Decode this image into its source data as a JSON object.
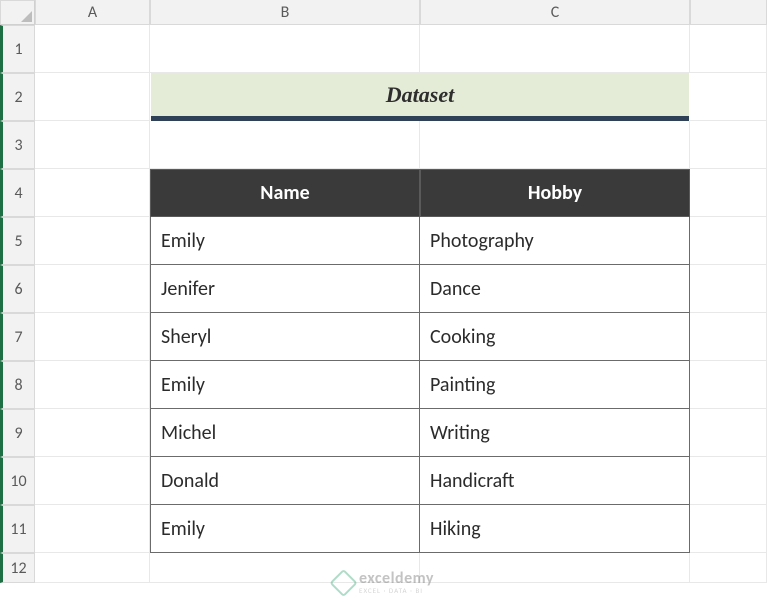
{
  "columns": [
    "A",
    "B",
    "C"
  ],
  "rows": [
    "1",
    "2",
    "3",
    "4",
    "5",
    "6",
    "7",
    "8",
    "9",
    "10",
    "11",
    "12"
  ],
  "title": "Dataset",
  "table": {
    "headers": [
      "Name",
      "Hobby"
    ],
    "data": [
      {
        "name": "Emily",
        "hobby": "Photography"
      },
      {
        "name": "Jenifer",
        "hobby": "Dance"
      },
      {
        "name": "Sheryl",
        "hobby": "Cooking"
      },
      {
        "name": "Emily",
        "hobby": "Painting"
      },
      {
        "name": "Michel",
        "hobby": "Writing"
      },
      {
        "name": "Donald",
        "hobby": "Handicraft"
      },
      {
        "name": "Emily",
        "hobby": "Hiking"
      }
    ]
  },
  "watermark": {
    "brand": "exceldemy",
    "tagline": "EXCEL · DATA · BI"
  }
}
